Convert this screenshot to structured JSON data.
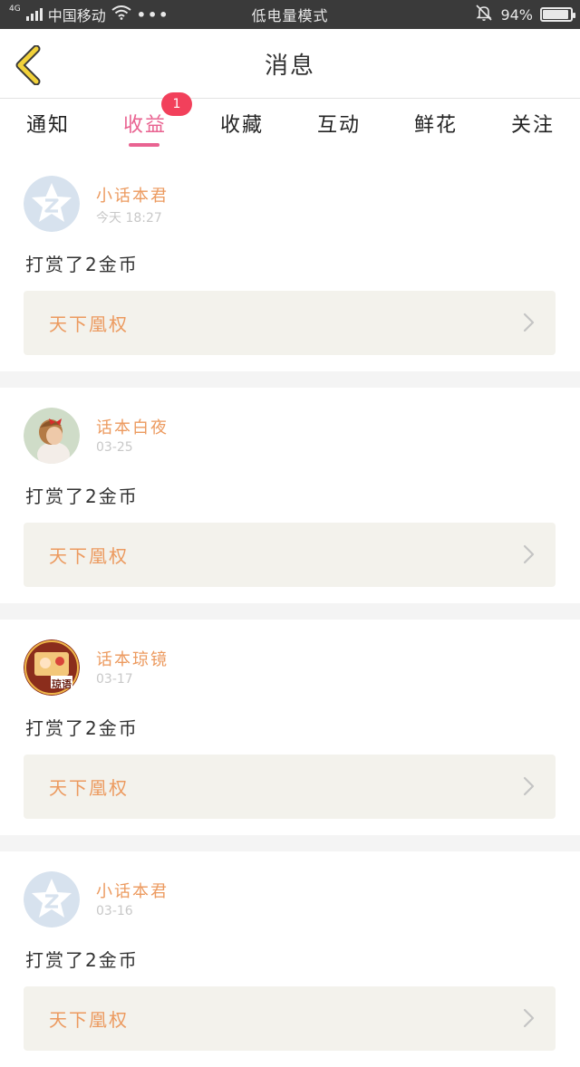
{
  "status_bar": {
    "network": "4G",
    "carrier": "中国移动",
    "more": "•••",
    "mode": "低电量模式",
    "battery": "94%",
    "battery_level": 0.94
  },
  "header": {
    "title": "消息"
  },
  "tabs": [
    {
      "label": "通知",
      "active": false
    },
    {
      "label": "收益",
      "active": true,
      "badge": "1"
    },
    {
      "label": "收藏",
      "active": false
    },
    {
      "label": "互动",
      "active": false
    },
    {
      "label": "鲜花",
      "active": false
    },
    {
      "label": "关注",
      "active": false
    }
  ],
  "feed": [
    {
      "username": "小话本君",
      "time": "今天 18:27",
      "message": "打赏了2金币",
      "book": "天下凰权",
      "avatar": "qq-default-avatar"
    },
    {
      "username": "话本白夜",
      "time": "03-25",
      "message": "打赏了2金币",
      "book": "天下凰权",
      "avatar": "girl-photo-avatar"
    },
    {
      "username": "话本琼镜",
      "time": "03-17",
      "message": "打赏了2金币",
      "book": "天下凰权",
      "avatar": "anime-avatar",
      "avatar_text": "琼语"
    },
    {
      "username": "小话本君",
      "time": "03-16",
      "message": "打赏了2金币",
      "book": "天下凰权",
      "avatar": "qq-default-avatar"
    }
  ],
  "colors": {
    "accent": "#e96391",
    "username": "#ec9a5f",
    "badge": "#f2405b",
    "book_box": "#f3f2ec",
    "status_bar": "#3a3a3a"
  }
}
